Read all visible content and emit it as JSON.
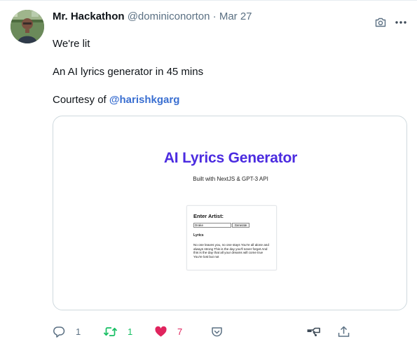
{
  "tweet": {
    "author_name": "Mr. Hackathon",
    "author_handle": "@dominiconorton",
    "separator": "·",
    "date": "Mar 27",
    "lines": [
      "We're lit",
      "An AI lyrics generator in 45 mins"
    ],
    "courtesy_prefix": "Courtesy of ",
    "courtesy_mention": "@harishkgarg"
  },
  "card": {
    "title": "AI Lyrics Generator",
    "subtitle": "Built with NextJS & GPT-3 API",
    "form_label": "Enter Artist:",
    "input_value": "Drake",
    "button_label": "Generate",
    "lyrics_label": "Lyrics",
    "lyrics_text": "No one leaves you, no one stays You're all alone and always strong This is the day you'll never forget And this is the day that all your dreams will come true You're lost but not"
  },
  "actions": {
    "reply_count": "1",
    "retweet_count": "1",
    "like_count": "7"
  },
  "icons": [
    "camera-icon",
    "more-icon",
    "reply-icon",
    "retweet-icon",
    "heart-icon",
    "save-icon",
    "promote-icon",
    "share-icon"
  ],
  "colors": {
    "mention": "#3a6fd1",
    "title_purple": "#4b2be0",
    "retweet_green": "#17bf63",
    "like_red": "#e0245e",
    "muted": "#5b7083"
  }
}
